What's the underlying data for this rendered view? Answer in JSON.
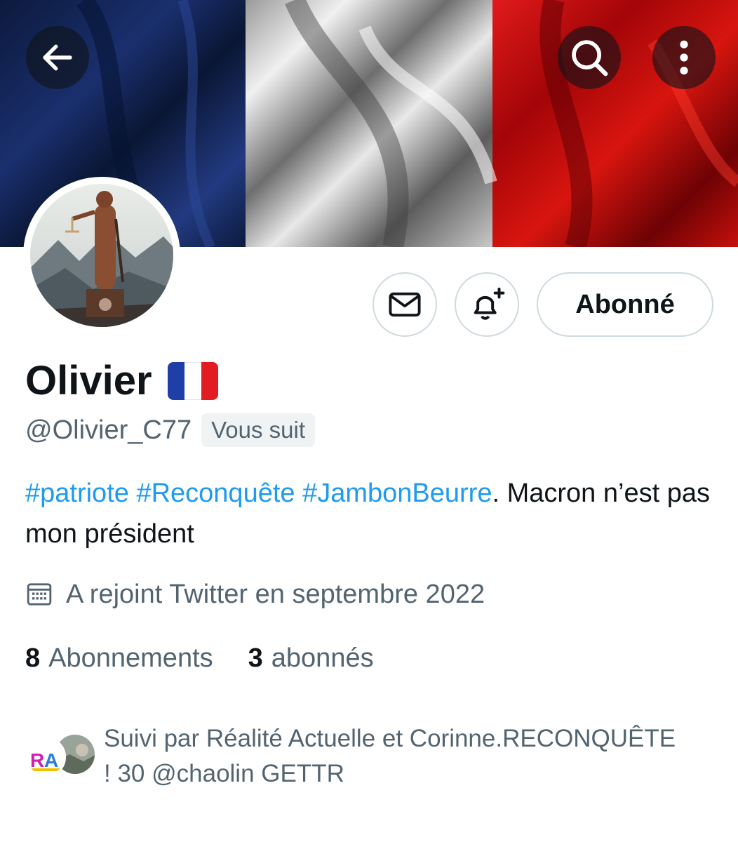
{
  "header": {
    "back_icon": "arrow-left-icon",
    "search_icon": "search-icon",
    "more_icon": "more-vertical-icon"
  },
  "banner": {
    "description": "French flag waving",
    "colors": {
      "blue": "#0b1f4f",
      "white": "#d9d9d9",
      "red": "#c4080c"
    }
  },
  "actions": {
    "message_icon": "mail-icon",
    "notify_icon": "bell-plus-icon",
    "follow_label": "Abonné"
  },
  "profile": {
    "display_name": "Olivier",
    "name_emoji": "🇫🇷",
    "handle": "@Olivier_C77",
    "follows_you": "Vous suit",
    "bio": {
      "hashtags": [
        "#patriote",
        "#Reconquête",
        "#JambonBeurre"
      ],
      "text": ". Macron n’est pas mon président"
    },
    "joined": "A rejoint Twitter en septembre 2022",
    "stats": {
      "following_count": "8",
      "following_label": "Abonnements",
      "followers_count": "3",
      "followers_label": "abonnés"
    },
    "followed_by": "Suivi par Réalité Actuelle et Corinne.RECONQUÊTE ! 30 @chaolin GETTR"
  },
  "colors": {
    "accent": "#1d9bf0",
    "secondary_text": "#536471",
    "primary_text": "#0f1419",
    "border": "#cfd9de"
  }
}
